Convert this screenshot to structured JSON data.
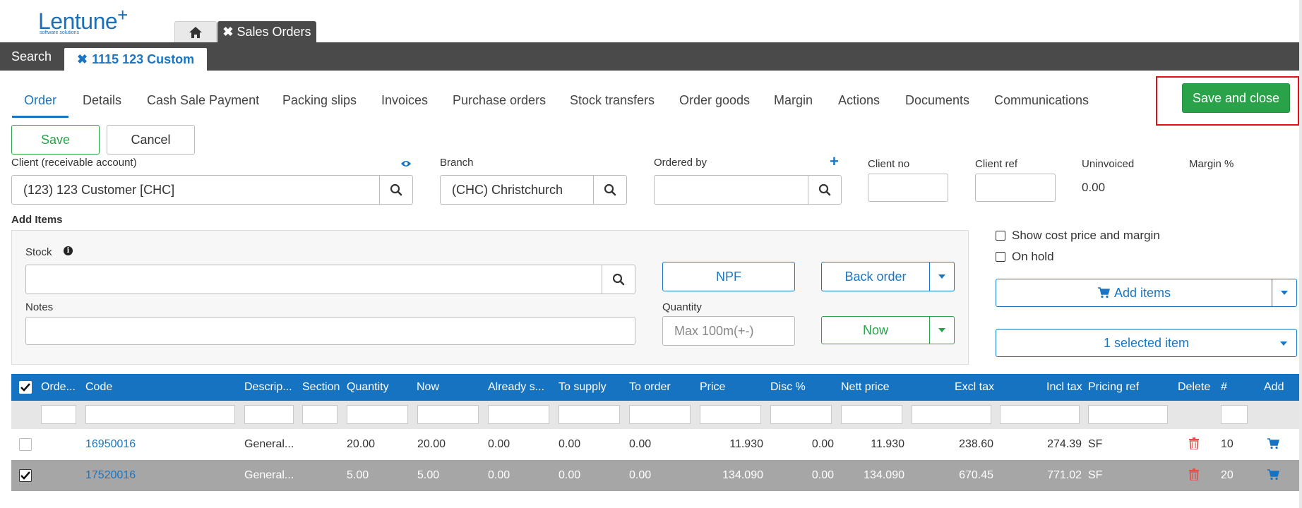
{
  "header": {
    "logo_text": "Lentune",
    "logo_plus": "+",
    "logo_tagline": "software solutions",
    "tabs": [
      {
        "label": "",
        "icon": "home-icon"
      },
      {
        "label": "Sales Orders",
        "icon": "close-icon"
      }
    ],
    "subtabs": [
      {
        "label": "Search"
      },
      {
        "label": "1115 123 Custom",
        "icon": "close-icon"
      }
    ]
  },
  "nav": {
    "tabs": [
      "Order",
      "Details",
      "Cash Sale Payment",
      "Packing slips",
      "Invoices",
      "Purchase orders",
      "Stock transfers",
      "Order goods",
      "Margin",
      "Actions",
      "Documents",
      "Communications"
    ],
    "active": "Order"
  },
  "actions": {
    "save_and_close": "Save and close",
    "save": "Save",
    "cancel": "Cancel"
  },
  "form": {
    "client_label": "Client (receivable account)",
    "client_value": "(123) 123 Customer [CHC]",
    "branch_label": "Branch",
    "branch_value": "(CHC) Christchurch",
    "ordered_by_label": "Ordered by",
    "ordered_by_value": "",
    "client_no_label": "Client no",
    "client_no_value": "",
    "client_ref_label": "Client ref",
    "client_ref_value": "",
    "uninvoiced_label": "Uninvoiced",
    "uninvoiced_value": "0.00",
    "margin_label": "Margin %",
    "margin_value": ""
  },
  "add_items": {
    "section_label": "Add Items",
    "stock_label": "Stock",
    "stock_value": "",
    "notes_label": "Notes",
    "notes_value": "",
    "npf_button": "NPF",
    "back_order_button": "Back order",
    "quantity_label": "Quantity",
    "quantity_placeholder": "Max 100m(+-)",
    "now_button": "Now",
    "show_cost_label": "Show cost price and margin",
    "show_cost_checked": false,
    "on_hold_label": "On hold",
    "on_hold_checked": false,
    "add_items_button": "Add items",
    "selected_items_button": "1 selected item"
  },
  "table": {
    "columns": [
      "Orde...",
      "Code",
      "Descrip...",
      "Section",
      "Quantity",
      "Now",
      "Already s...",
      "To supply",
      "To order",
      "Price",
      "Disc %",
      "Nett price",
      "Excl tax",
      "Incl tax",
      "Pricing ref",
      "Delete",
      "#",
      "Add"
    ],
    "rows": [
      {
        "checked": false,
        "code": "16950016",
        "description": "General...",
        "section": "",
        "quantity": "20.00",
        "now": "20.00",
        "already_supplied": "0.00",
        "to_supply": "0.00",
        "to_order": "0.00",
        "price": "11.930",
        "disc": "0.00",
        "nett_price": "11.930",
        "excl_tax": "238.60",
        "incl_tax": "274.39",
        "pricing_ref": "SF",
        "num": "10",
        "highlight": false
      },
      {
        "checked": true,
        "code": "17520016",
        "description": "General...",
        "section": "",
        "quantity": "5.00",
        "now": "5.00",
        "already_supplied": "0.00",
        "to_supply": "0.00",
        "to_order": "0.00",
        "price": "134.090",
        "disc": "0.00",
        "nett_price": "134.090",
        "excl_tax": "670.45",
        "incl_tax": "771.02",
        "pricing_ref": "SF",
        "num": "20",
        "highlight": true
      }
    ]
  },
  "colors": {
    "brand_blue": "#1a76c2",
    "table_header": "#1673c1",
    "green": "#2aa24a",
    "highlight_frame": "#e3101a",
    "selected_row": "#a6a6a6",
    "delete_red": "#e0504a"
  }
}
